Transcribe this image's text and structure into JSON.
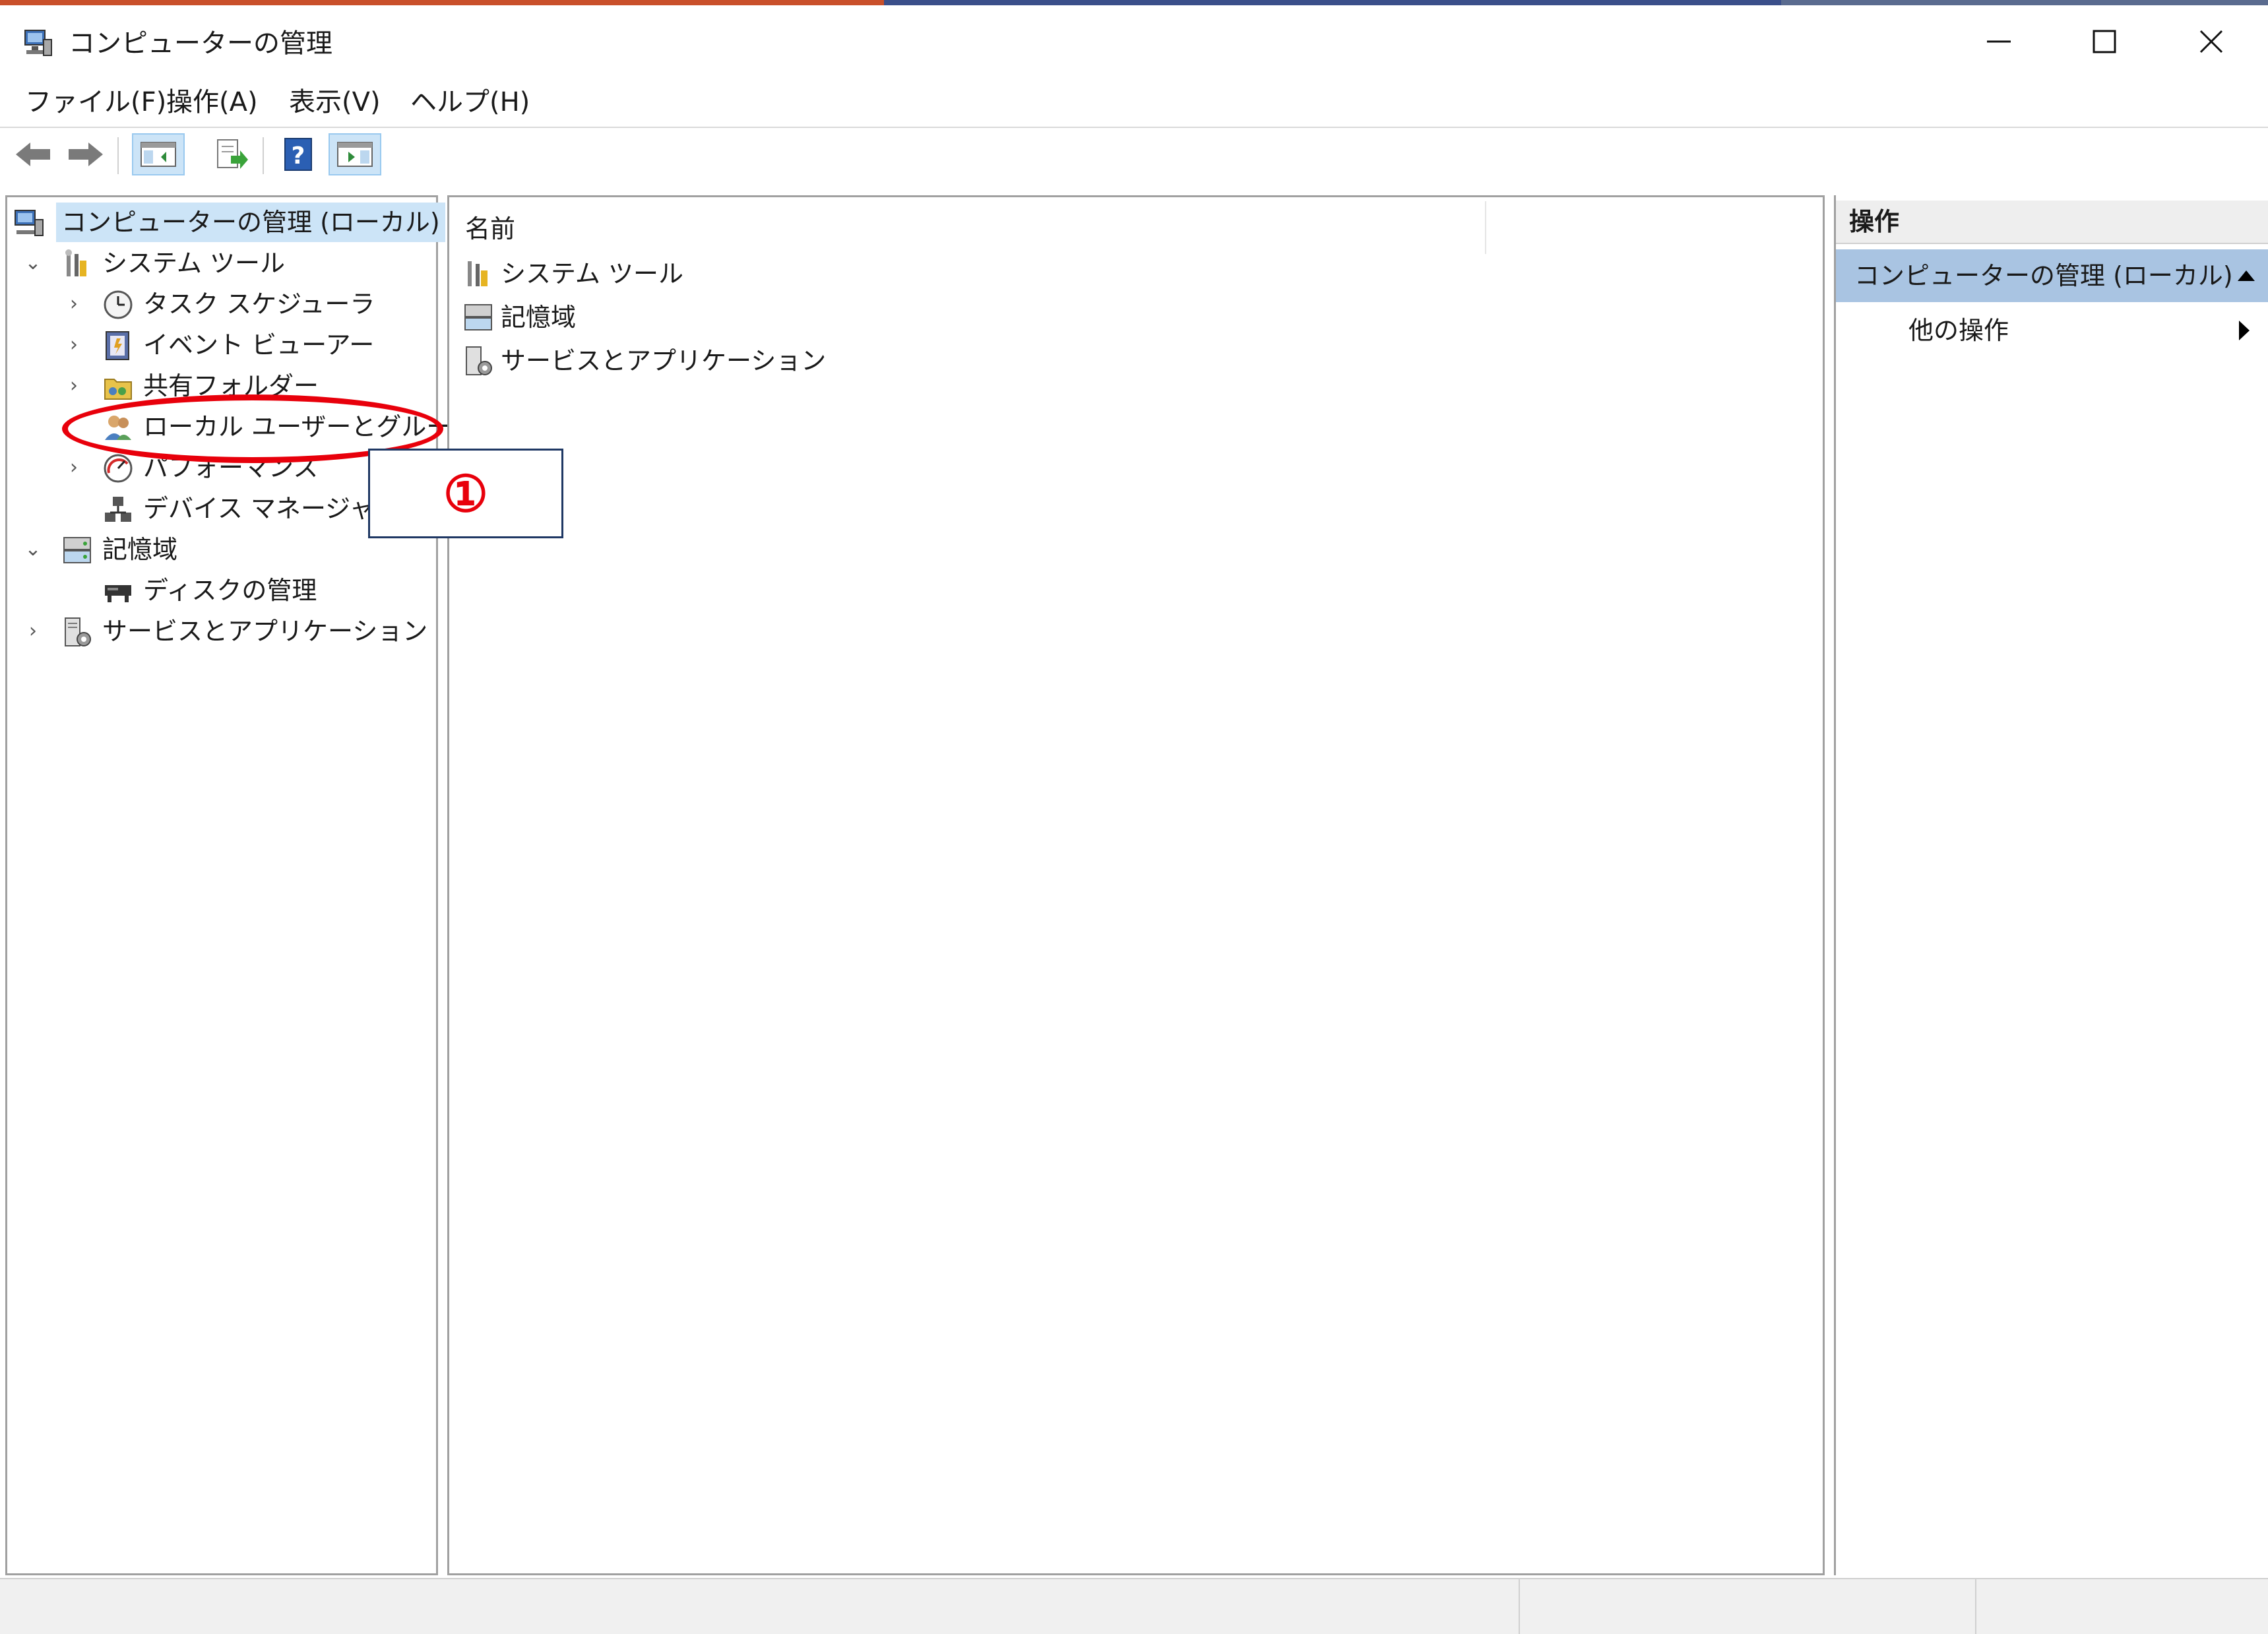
{
  "window": {
    "title": "コンピューターの管理",
    "controls": {
      "minimize": "—",
      "maximize": "☐",
      "close": "✕"
    }
  },
  "menu": [
    "ファイル(F)",
    "操作(A)",
    "表示(V)",
    "ヘルプ(H)"
  ],
  "toolbar": {
    "buttons": [
      "back-icon",
      "forward-icon",
      "show-hide-console-tree-icon",
      "export-list-icon",
      "help-icon",
      "show-hide-action-pane-icon"
    ]
  },
  "tree": {
    "root": "コンピューターの管理 (ローカル)",
    "system_tools": "システム ツール",
    "task_scheduler": "タスク スケジューラ",
    "event_viewer": "イベント ビューアー",
    "shared_folders": "共有フォルダー",
    "local_users_groups": "ローカル ユーザーとグループ",
    "performance": "パフォーマンス",
    "device_manager": "デバイス マネージャー",
    "storage": "記憶域",
    "disk_management": "ディスクの管理",
    "services_apps": "サービスとアプリケーション"
  },
  "list": {
    "column_name": "名前",
    "items": [
      "システム ツール",
      "記憶域",
      "サービスとアプリケーション"
    ]
  },
  "actions": {
    "title": "操作",
    "section": "コンピューターの管理 (ローカル)",
    "other": "他の操作"
  },
  "annotation": {
    "label": "①",
    "highlight_color": "#e8000b"
  },
  "colors": {
    "selection": "#cce4f7",
    "actions_section_bg": "#a9c4e2"
  }
}
